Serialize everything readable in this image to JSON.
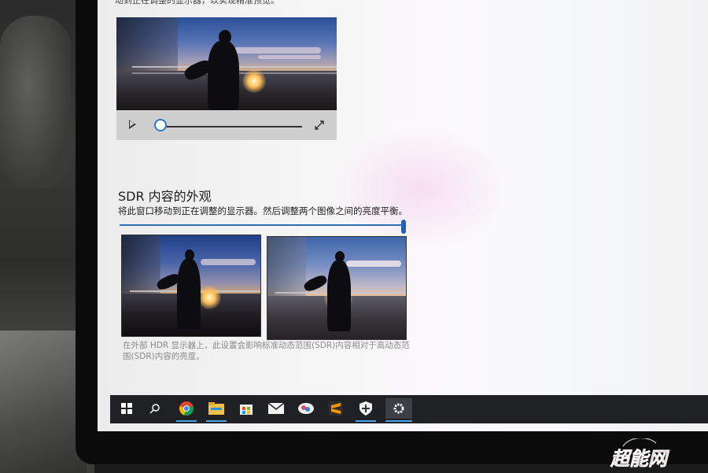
{
  "top_fragment": "动到正在调整的显示器，以实现精准预览。",
  "sdr": {
    "title": "SDR 内容的外观",
    "description": "将此窗口移动到正在调整的显示器。然后调整两个图像之间的亮度平衡。",
    "slider_value_percent": 100,
    "note": "在外部 HDR 显示器上，此设置会影响标准动态范围(SDR)内容相对于高动态范围(SDR)内容的亮度。"
  },
  "video": {
    "progress_percent": 0
  },
  "taskbar": {
    "icons": [
      "windows-start-icon",
      "search-icon",
      "chrome-icon",
      "file-explorer-icon",
      "store-icon",
      "mail-icon",
      "photos-icon",
      "sublime-icon",
      "windows-security-icon",
      "settings-icon"
    ],
    "accent": "#4aa3e8"
  },
  "watermark": {
    "text": "超能网",
    "color": "#c0392b"
  }
}
